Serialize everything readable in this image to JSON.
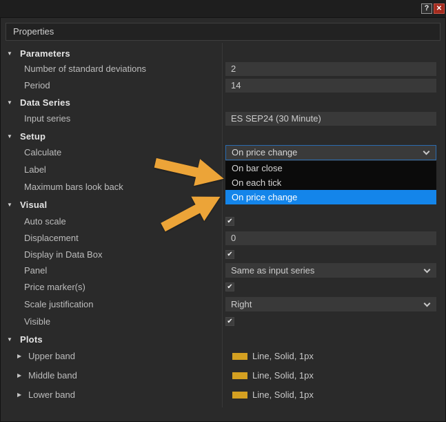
{
  "titlebar": {
    "help_icon": "?",
    "close_icon": "✕"
  },
  "header": {
    "title": "Properties"
  },
  "icons": {
    "section_expanded": "▼",
    "plot_collapsed": "▶",
    "check": "✔"
  },
  "colors": {
    "panel_bg": "#2a2a2a",
    "field_bg": "#393939",
    "popup_bg": "#0b0b0b",
    "selection_blue": "#1485ea",
    "combobox_focus_border": "#2b6cb0",
    "arrow_orange": "#eca438",
    "plot_swatch_gold": "#d4a021",
    "close_button_red": "#a42b1e"
  },
  "grid": {
    "sections": [
      {
        "title": "Parameters",
        "rows": [
          {
            "label": "Number of standard deviations",
            "value": "2",
            "control": "textbox"
          },
          {
            "label": "Period",
            "value": "14",
            "control": "textbox"
          }
        ]
      },
      {
        "title": "Data Series",
        "rows": [
          {
            "label": "Input series",
            "value": "ES SEP24 (30 Minute)",
            "control": "textbox"
          }
        ]
      },
      {
        "title": "Setup",
        "rows": [
          {
            "label": "Calculate",
            "value": "On price change",
            "control": "combobox-open",
            "options": [
              "On bar close",
              "On each tick",
              "On price change"
            ],
            "selected_option": "On price change"
          },
          {
            "label": "Label",
            "control": "hidden-behind-popup"
          },
          {
            "label": "Maximum bars look back",
            "control": "hidden-behind-popup"
          }
        ]
      },
      {
        "title": "Visual",
        "rows": [
          {
            "label": "Auto scale",
            "control": "checkbox",
            "checked": true
          },
          {
            "label": "Displacement",
            "value": "0",
            "control": "textbox"
          },
          {
            "label": "Display in Data Box",
            "control": "checkbox",
            "checked": true
          },
          {
            "label": "Panel",
            "value": "Same as input series",
            "control": "dropdown"
          },
          {
            "label": "Price marker(s)",
            "control": "checkbox",
            "checked": true
          },
          {
            "label": "Scale justification",
            "value": "Right",
            "control": "dropdown"
          },
          {
            "label": "Visible",
            "control": "checkbox",
            "checked": true
          }
        ]
      },
      {
        "title": "Plots",
        "rows": [
          {
            "label": "Upper band",
            "value": "Line, Solid, 1px",
            "swatch_color": "#d4a021"
          },
          {
            "label": "Middle band",
            "value": "Line, Solid, 1px",
            "swatch_color": "#d4a021"
          },
          {
            "label": "Lower band",
            "value": "Line, Solid, 1px",
            "swatch_color": "#d4a021"
          }
        ]
      }
    ]
  }
}
